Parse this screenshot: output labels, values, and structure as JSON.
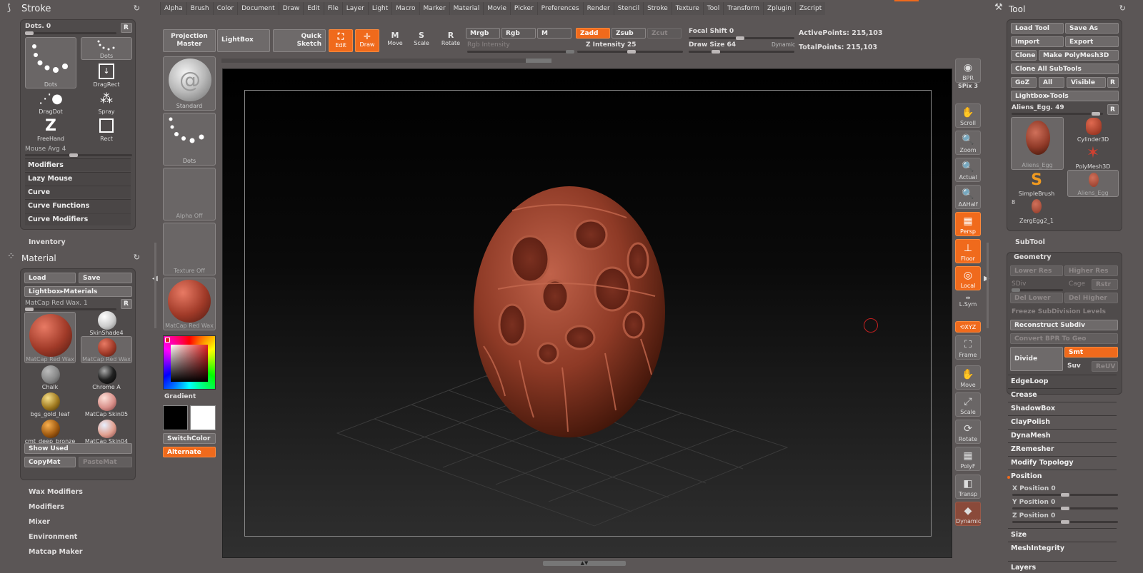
{
  "menu": [
    "Alpha",
    "Brush",
    "Color",
    "Document",
    "Draw",
    "Edit",
    "File",
    "Layer",
    "Light",
    "Macro",
    "Marker",
    "Material",
    "Movie",
    "Picker",
    "Preferences",
    "Render",
    "Stencil",
    "Stroke",
    "Texture",
    "Tool",
    "Transform",
    "Zplugin",
    "Zscript"
  ],
  "top": {
    "projection_master": "Projection Master",
    "lightbox": "LightBox",
    "quick_sketch": "Quick Sketch",
    "edit": "Edit",
    "draw": "Draw",
    "move": "Move",
    "scale": "Scale",
    "rotate": "Rotate",
    "mrgb": "Mrgb",
    "rgb": "Rgb",
    "m": "M",
    "zadd": "Zadd",
    "zsub": "Zsub",
    "zcut": "Zcut",
    "rgb_intensity": "Rgb Intensity",
    "z_intensity": "Z Intensity 25",
    "focal_shift": "Focal Shift 0",
    "draw_size": "Draw Size 64",
    "dynamic": "Dynamic",
    "active_points": "ActivePoints: 215,103",
    "total_points": "TotalPoints: 215,103"
  },
  "stroke": {
    "title": "Stroke",
    "dots_label": "Dots. 0",
    "r": "R",
    "items": [
      "Dots",
      "Dots",
      "DragRect",
      "DragDot",
      "Spray",
      "FreeHand",
      "Rect"
    ],
    "mouse_avg": "Mouse Avg 4",
    "sections": [
      "Modifiers",
      "Lazy Mouse",
      "Curve",
      "Curve Functions",
      "Curve Modifiers"
    ]
  },
  "inventory": "Inventory",
  "material": {
    "title": "Material",
    "load": "Load",
    "save": "Save",
    "lightbox": "Lightbox▸Materials",
    "current": "MatCap Red Wax. 1",
    "r": "R",
    "items": [
      "MatCap Red Wax",
      "SkinShade4",
      "MatCap Red Wax",
      "Chalk",
      "Chrome A",
      "bgs_gold_leaf",
      "MatCap Skin05",
      "cmt_deep_bronze",
      "MatCap Skin04"
    ],
    "show_used": "Show Used",
    "copymat": "CopyMat",
    "pastemat": "PasteMat",
    "sections": [
      "Wax Modifiers",
      "Modifiers",
      "Mixer",
      "Environment",
      "Matcap Maker"
    ]
  },
  "shelf": {
    "standard": "Standard",
    "dots": "Dots",
    "alpha_off": "Alpha Off",
    "texture_off": "Texture Off",
    "material": "MatCap Red Wax",
    "gradient": "Gradient",
    "switch_color": "SwitchColor",
    "alternate": "Alternate"
  },
  "right_shelf": [
    {
      "label": "BPR",
      "icon": "bpr-icon"
    },
    {
      "label": "SPix 3",
      "icon": "none"
    },
    {
      "label": "Scroll",
      "icon": "hand-icon"
    },
    {
      "label": "Zoom",
      "icon": "zoom-icon"
    },
    {
      "label": "Actual",
      "icon": "zoom-icon"
    },
    {
      "label": "AAHalf",
      "icon": "zoom-icon"
    },
    {
      "label": "Persp",
      "icon": "grid-icon"
    },
    {
      "label": "Floor",
      "icon": "floor-icon"
    },
    {
      "label": "Local",
      "icon": "local-icon"
    },
    {
      "label": "L.Sym",
      "icon": "sym-icon"
    },
    {
      "label": "⟲XYZ",
      "icon": "xyz-icon"
    },
    {
      "label": "Frame",
      "icon": "frame-icon"
    },
    {
      "label": "Move",
      "icon": "hand-icon"
    },
    {
      "label": "Scale",
      "icon": "scale-icon"
    },
    {
      "label": "Rotate",
      "icon": "rotate-icon"
    },
    {
      "label": "PolyF",
      "icon": "grid-icon"
    },
    {
      "label": "Transp",
      "icon": "transp-icon"
    },
    {
      "label": "Dynamic",
      "icon": "dynamic-icon"
    }
  ],
  "tool": {
    "title": "Tool",
    "load_tool": "Load Tool",
    "save_as": "Save As",
    "import": "Import",
    "export": "Export",
    "clone": "Clone",
    "make_polymesh": "Make PolyMesh3D",
    "clone_all": "Clone All SubTools",
    "goz": "GoZ",
    "all": "All",
    "visible": "Visible",
    "r": "R",
    "lightbox_tools": "Lightbox▸Tools",
    "current": "Aliens_Egg. 49",
    "items": [
      "Aliens_Egg",
      "Cylinder3D",
      "PolyMesh3D",
      "SimpleBrush",
      "Aliens_Egg",
      "ZergEgg2_1"
    ],
    "count": "8",
    "subtool": "SubTool",
    "geometry": "Geometry",
    "lower_res": "Lower Res",
    "higher_res": "Higher Res",
    "sdiv": "SDiv",
    "cage": "Cage",
    "rstr": "Rstr",
    "del_lower": "Del Lower",
    "del_higher": "Del Higher",
    "freeze": "Freeze SubDivision Levels",
    "reconstruct": "Reconstruct Subdiv",
    "convert_bpr": "Convert BPR To Geo",
    "divide": "Divide",
    "smt": "Smt",
    "suv": "Suv",
    "rsmt": "ReUV",
    "sections": [
      "EdgeLoop",
      "Crease",
      "ShadowBox",
      "ClayPolish",
      "DynaMesh",
      "ZRemesher",
      "Modify Topology"
    ],
    "position": "Position",
    "x_position": "X Position 0",
    "y_position": "Y Position 0",
    "z_position": "Z Position 0",
    "size": "Size",
    "mesh_integrity": "MeshIntegrity",
    "layers": "Layers"
  },
  "colors": {
    "accent": "#f06a1c",
    "bg": "#5b5656",
    "canvas": "#0c0c0c",
    "egg": "#a0402c"
  }
}
